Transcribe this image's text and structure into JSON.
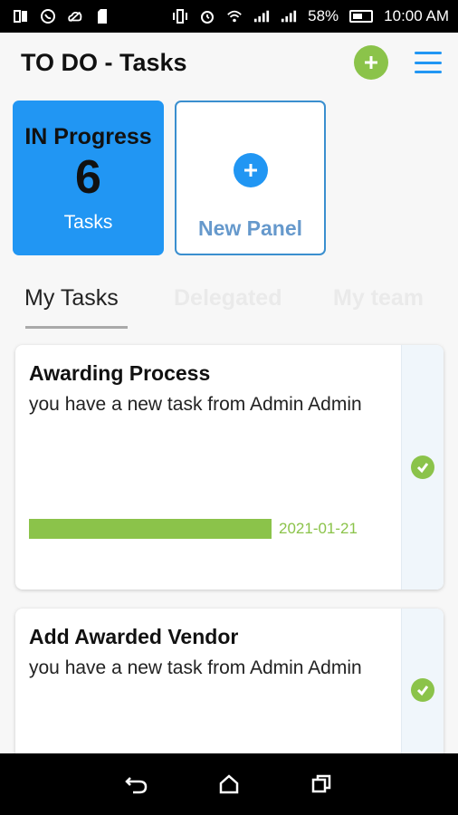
{
  "status_bar": {
    "battery": "58%",
    "time": "10:00 AM",
    "left_icons": [
      "sim-icon",
      "whatsapp-icon",
      "cloud-off-icon",
      "sd-card-icon"
    ],
    "right_icons": [
      "vibrate-icon",
      "alarm-icon",
      "wifi-icon",
      "signal-icon",
      "signal-icon",
      "battery-icon"
    ]
  },
  "header": {
    "title": "TO DO - Tasks",
    "add_icon": "plus-icon",
    "menu_icon": "hamburger-icon"
  },
  "panels": {
    "progress": {
      "label": "IN Progress",
      "count": "6",
      "sub": "Tasks"
    },
    "new": {
      "label": "New Panel",
      "icon": "plus-icon"
    }
  },
  "tabs": [
    {
      "label": "My Tasks",
      "active": true
    },
    {
      "label": "Delegated",
      "active": false
    },
    {
      "label": "My team",
      "active": false
    }
  ],
  "tasks": [
    {
      "title": "Awarding Process",
      "body": "you have a new task from Admin Admin",
      "progress": 1.0,
      "date": "2021-01-21"
    },
    {
      "title": "Add Awarded Vendor",
      "body": "you have a new task from Admin Admin"
    }
  ],
  "colors": {
    "accent": "#2196f3",
    "green": "#8bc34a"
  }
}
